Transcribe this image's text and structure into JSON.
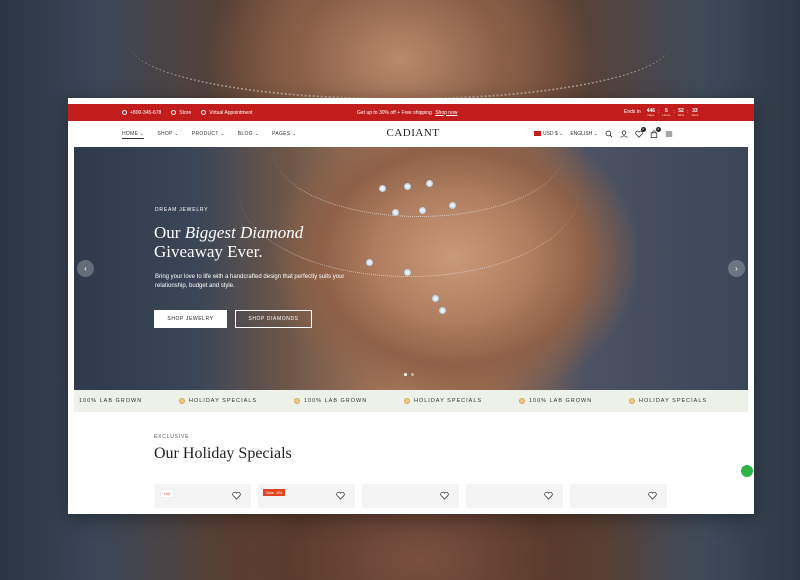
{
  "colors": {
    "announcement_bg": "#c11d1d",
    "sale_tag": "#e04422",
    "marquee_bg": "#eef0ea"
  },
  "topbar": {
    "phone": "+800-345-678",
    "store": "Store",
    "virtual": "Virtual Appointment",
    "promo": "Get up to 30% off + Free shipping",
    "promo_link": "Shop now",
    "ends_in": "Ends in",
    "countdown": [
      {
        "value": "446",
        "unit": "Days"
      },
      {
        "value": "5",
        "unit": "Hours"
      },
      {
        "value": "52",
        "unit": "Mins"
      },
      {
        "value": "33",
        "unit": "Secs"
      }
    ]
  },
  "nav": {
    "logo": "CADIANT",
    "menu": [
      "HOME",
      "SHOP",
      "PRODUCT",
      "BLOG",
      "PAGES"
    ],
    "currency": "USD $",
    "language": "ENGLISH",
    "wishlist_count": "0",
    "cart_count": "0"
  },
  "hero": {
    "eyebrow": "DREAM JEWELRY",
    "title_pre": "Our ",
    "title_em": "Biggest Diamond",
    "title_post": "Giveaway Ever.",
    "description": "Bring your love to life with a handcrafted design that perfectly suits your relationship, budget and style.",
    "primary_button": "SHOP JEWELRY",
    "secondary_button": "SHOP DIAMONDS"
  },
  "marquee": [
    "100% LAB GROWN",
    "HOLIDAY SPECIALS",
    "100% LAB GROWN",
    "HOLIDAY SPECIALS",
    "100% LAB GROWN",
    "HOLIDAY SPECIALS"
  ],
  "specials": {
    "eyebrow": "EXCLUSIVE",
    "title": "Our Holiday Specials",
    "cards": [
      {
        "tag": "Hot",
        "tag_type": "hot"
      },
      {
        "tag": "Sale -4%",
        "tag_type": "sale"
      },
      {
        "tag": "",
        "tag_type": ""
      },
      {
        "tag": "",
        "tag_type": ""
      },
      {
        "tag": "",
        "tag_type": ""
      }
    ]
  }
}
